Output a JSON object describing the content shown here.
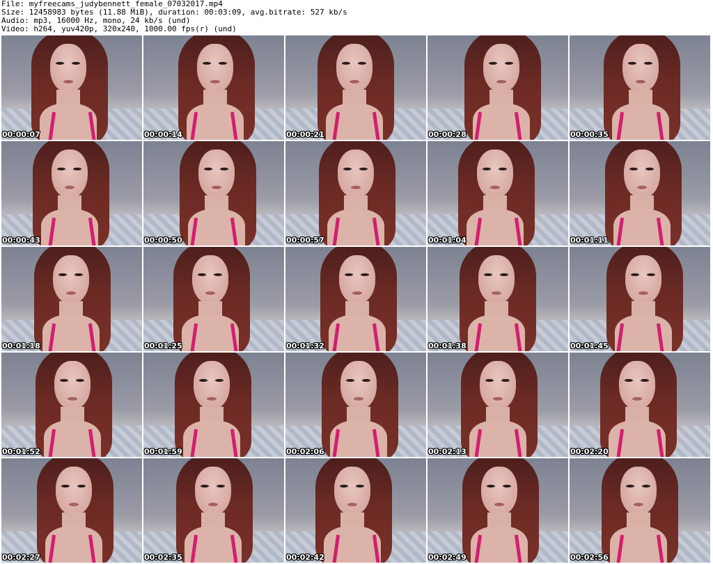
{
  "header": {
    "file_line": "File: myfreecams_judybennett_female_07032017.mp4",
    "size_line": "Size: 12458983 bytes (11.88 MiB), duration: 00:03:09, avg.bitrate: 527 kb/s",
    "audio_line": "Audio: mp3, 16000 Hz, mono, 24 kb/s (und)",
    "video_line": "Video: h264, yuv420p, 320x240, 1000.00 fps(r) (und)"
  },
  "thumbnails": [
    {
      "timestamp": "00:00:07"
    },
    {
      "timestamp": "00:00:14"
    },
    {
      "timestamp": "00:00:21"
    },
    {
      "timestamp": "00:00:28"
    },
    {
      "timestamp": "00:00:35"
    },
    {
      "timestamp": "00:00:43"
    },
    {
      "timestamp": "00:00:50"
    },
    {
      "timestamp": "00:00:57"
    },
    {
      "timestamp": "00:01:04"
    },
    {
      "timestamp": "00:01:11"
    },
    {
      "timestamp": "00:01:18"
    },
    {
      "timestamp": "00:01:25"
    },
    {
      "timestamp": "00:01:32"
    },
    {
      "timestamp": "00:01:38"
    },
    {
      "timestamp": "00:01:45"
    },
    {
      "timestamp": "00:01:52"
    },
    {
      "timestamp": "00:01:59"
    },
    {
      "timestamp": "00:02:06"
    },
    {
      "timestamp": "00:02:13"
    },
    {
      "timestamp": "00:02:20"
    },
    {
      "timestamp": "00:02:27"
    },
    {
      "timestamp": "00:02:35"
    },
    {
      "timestamp": "00:02:42"
    },
    {
      "timestamp": "00:02:49"
    },
    {
      "timestamp": "00:02:56"
    }
  ],
  "colors": {
    "page_background": "#ffffff",
    "header_text": "#000000",
    "timestamp_text": "#ffffff",
    "timestamp_outline": "#000000",
    "top_accent": "#d21f6e"
  }
}
